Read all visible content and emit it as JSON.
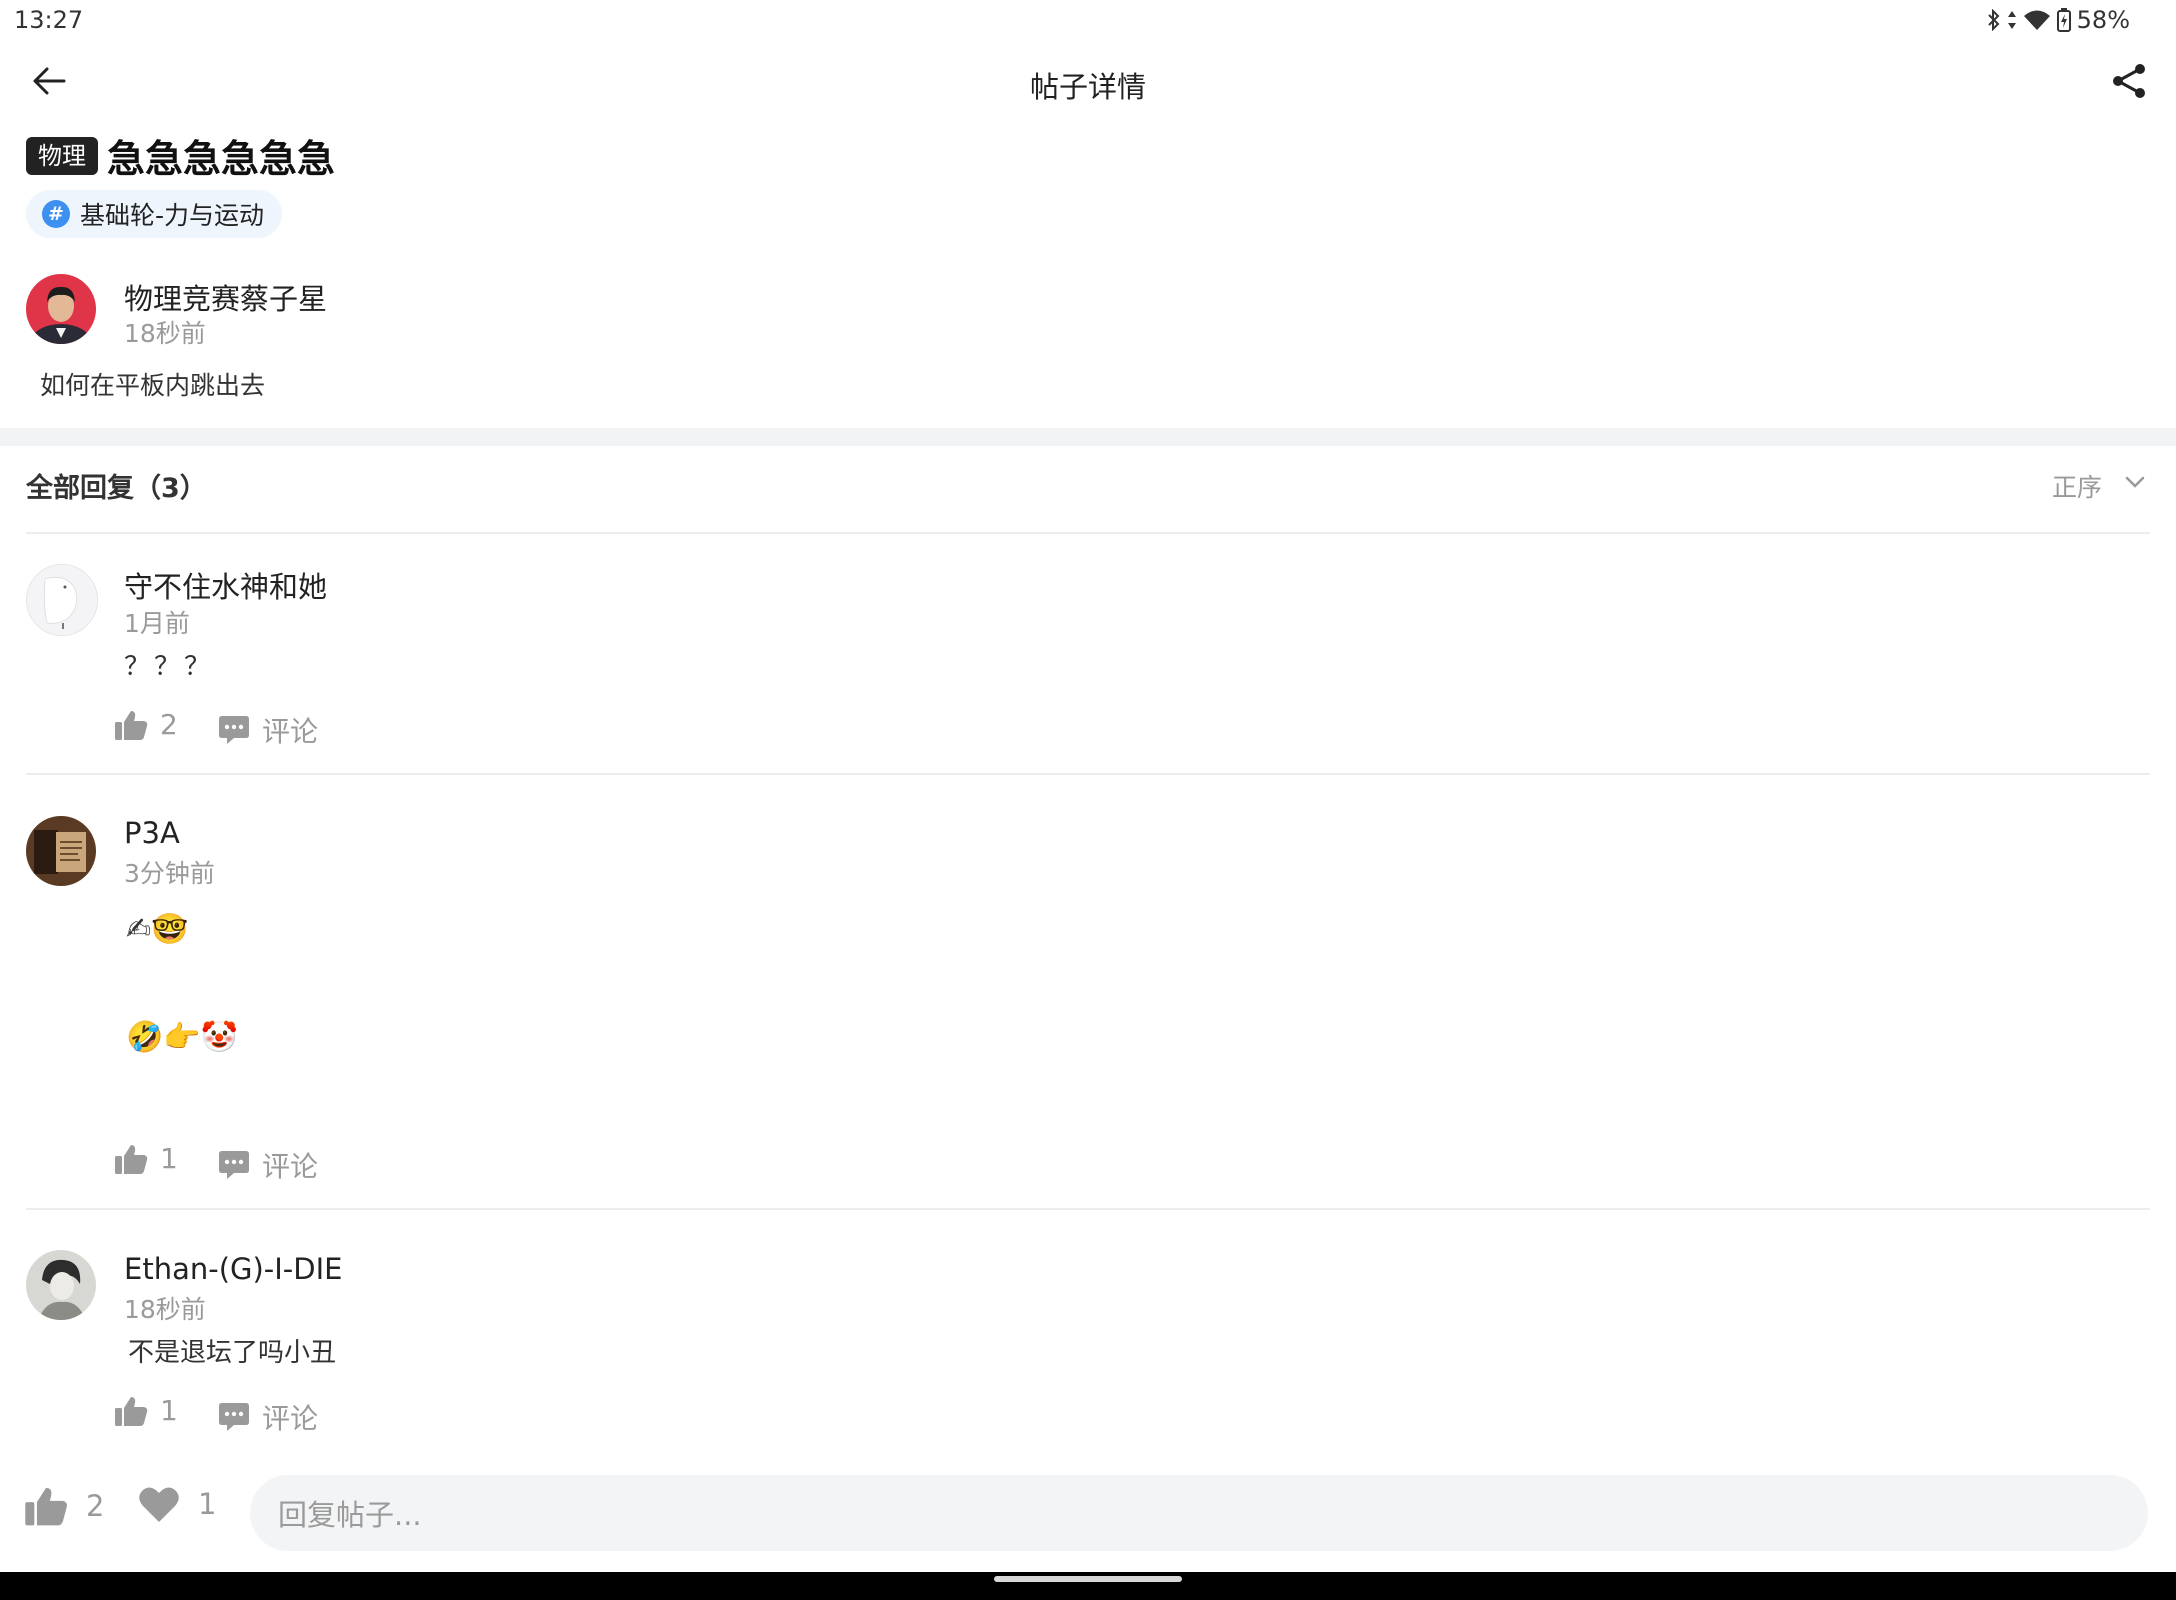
{
  "status_bar": {
    "time": "13:27",
    "battery": "58%"
  },
  "header": {
    "title": "帖子详情"
  },
  "post": {
    "subject_tag": "物理",
    "title": "急急急急急急",
    "topic": "基础轮-力与运动",
    "author": "物理竞赛蔡子星",
    "time": "18秒前",
    "body": "如何在平板内跳出去"
  },
  "replies_header": {
    "title": "全部回复（3）",
    "sort": "正序"
  },
  "replies": [
    {
      "author": "守不住水神和她",
      "time": "1月前",
      "text": "？？？",
      "likes": "2",
      "comment_label": "评论"
    },
    {
      "author": "P3A",
      "time": "3分钟前",
      "line1": "✍🤓",
      "line2": "🤣👉🤡",
      "likes": "1",
      "comment_label": "评论"
    },
    {
      "author": "Ethan-(G)-I-DIE",
      "time": "18秒前",
      "text": "不是退坛了吗小丑",
      "likes": "1",
      "comment_label": "评论"
    }
  ],
  "bottom_bar": {
    "likes": "2",
    "favorites": "1",
    "reply_placeholder": "回复帖子..."
  },
  "colors": {
    "accent": "#3d8ff0",
    "icon_gray": "#9a9a9a",
    "divider": "#ececec"
  }
}
